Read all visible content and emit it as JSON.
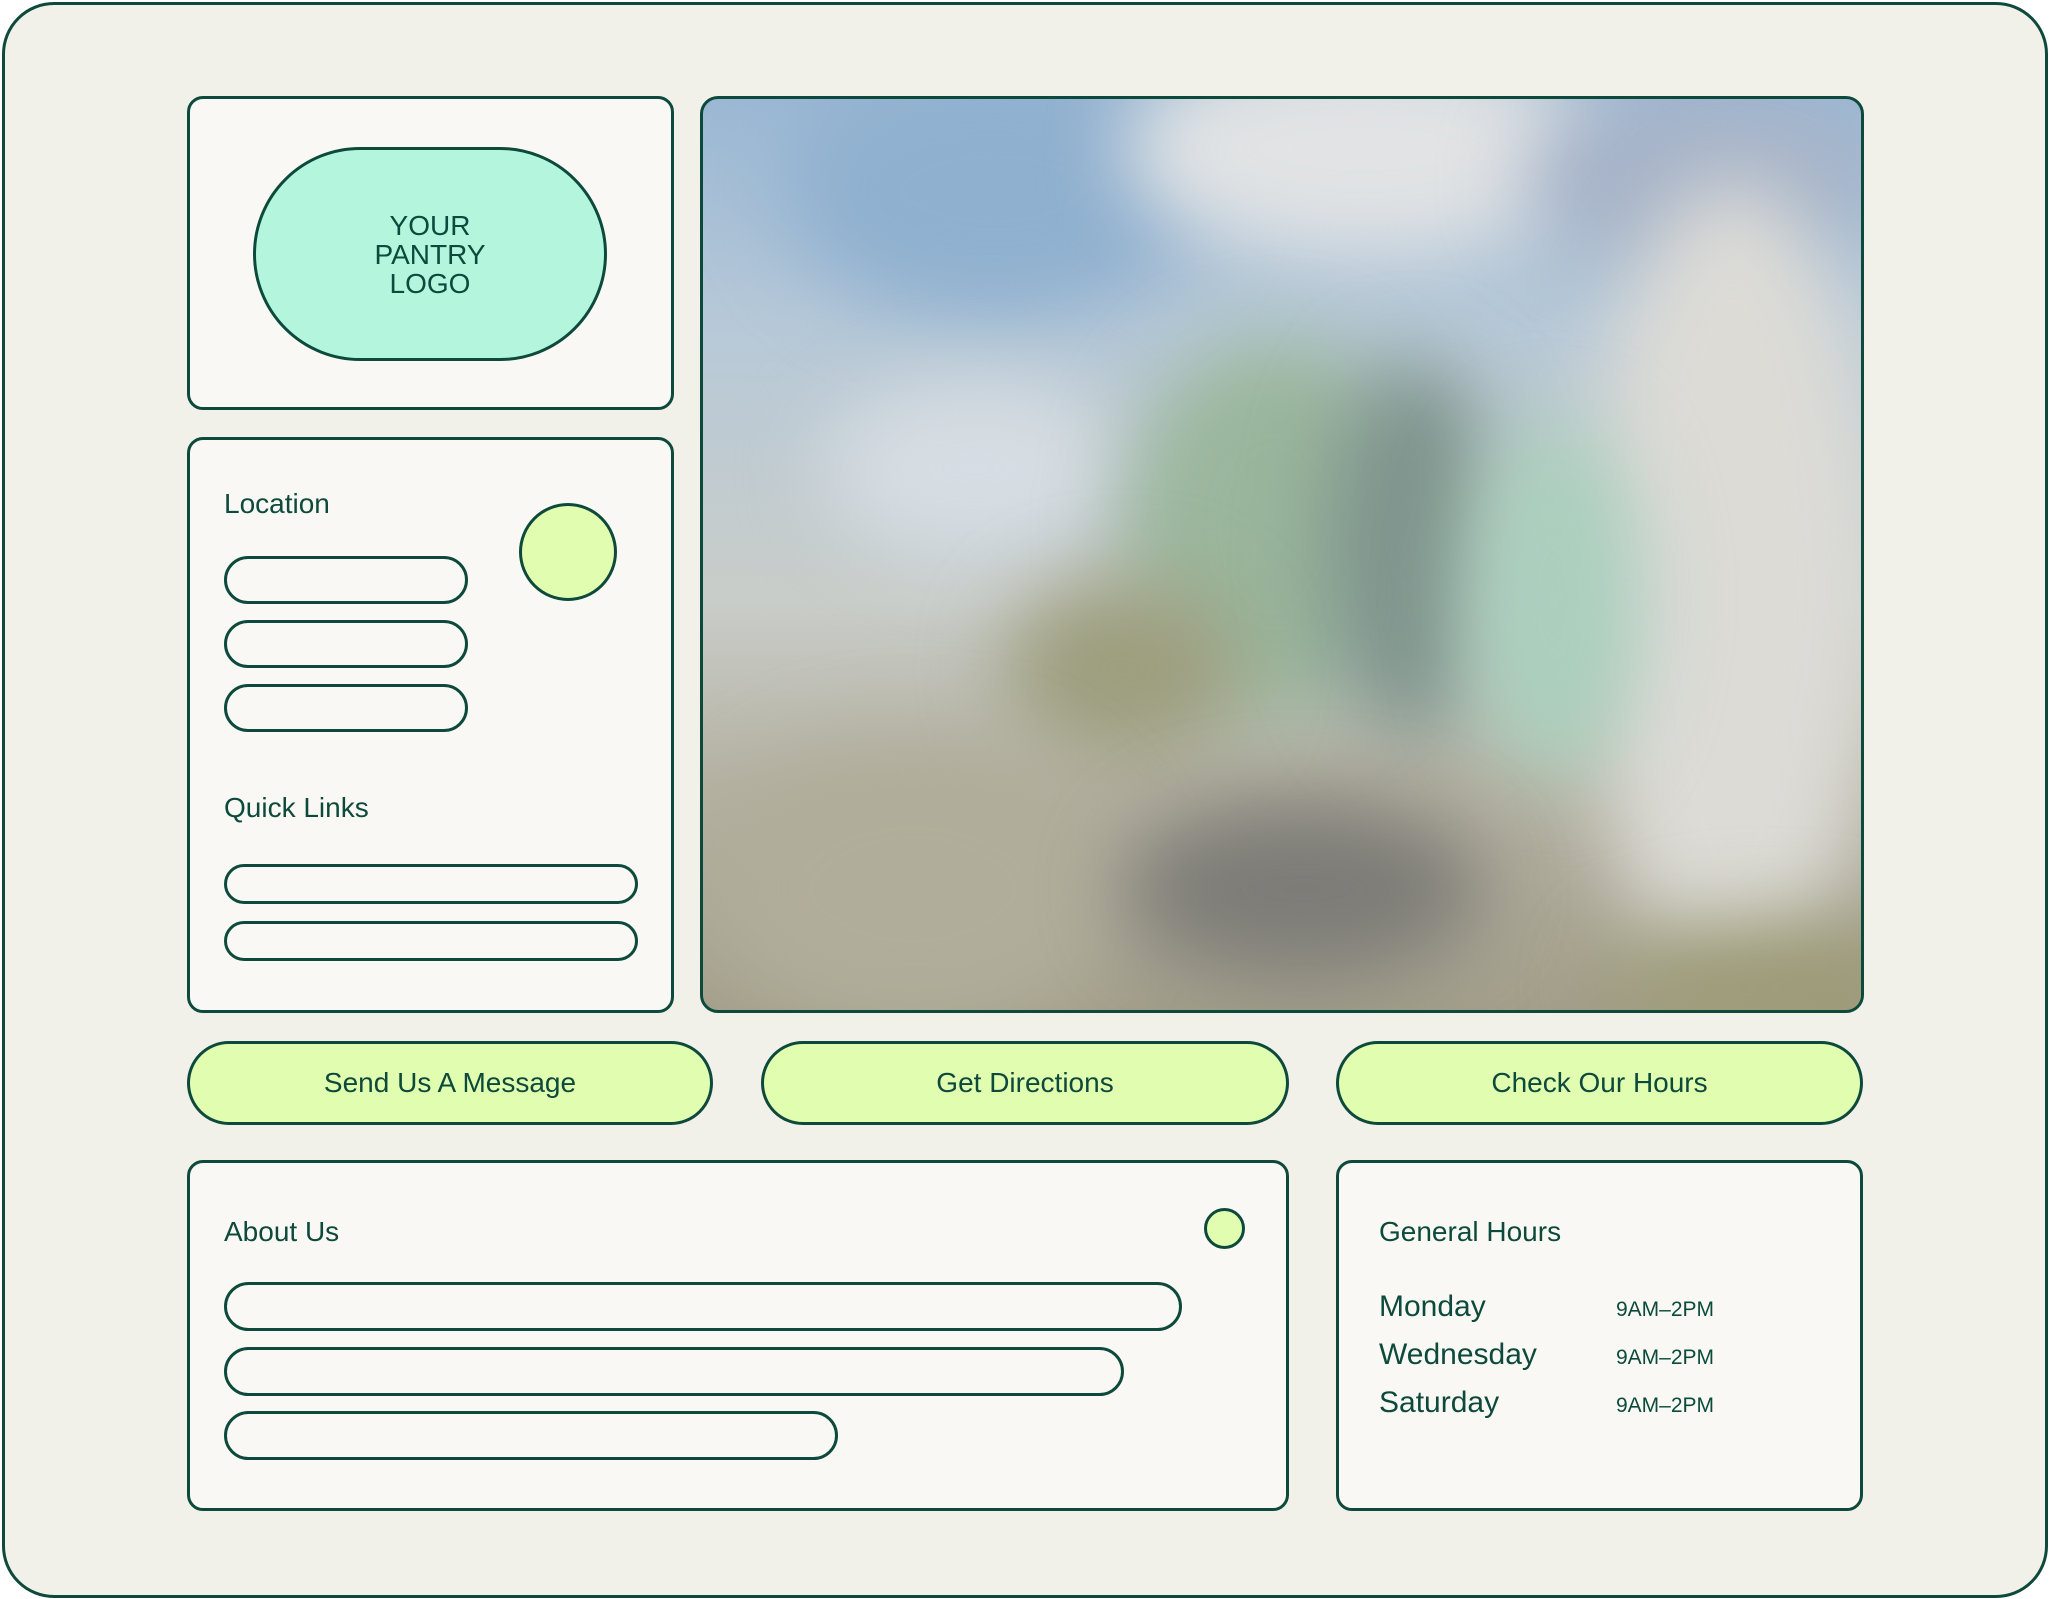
{
  "logo": {
    "text": "YOUR\nPANTRY\nLOGO"
  },
  "location": {
    "heading": "Location"
  },
  "quick_links": {
    "heading": "Quick Links"
  },
  "actions": {
    "message": "Send Us A Message",
    "directions": "Get Directions",
    "hours": "Check Our Hours"
  },
  "about": {
    "heading": "About Us"
  },
  "hours": {
    "heading": "General Hours",
    "rows": [
      {
        "day": "Monday",
        "time": "9AM–2PM"
      },
      {
        "day": "Wednesday",
        "time": "9AM–2PM"
      },
      {
        "day": "Saturday",
        "time": "9AM–2PM"
      }
    ]
  },
  "colors": {
    "ink": "#0d4a3c",
    "frame_bg": "#f1f1ea",
    "card_bg": "#f9f8f4",
    "logo_fill": "#b3f5dd",
    "accent": "#e0fdb0"
  },
  "photo": {
    "icon": "storefront-photo-blurred"
  }
}
